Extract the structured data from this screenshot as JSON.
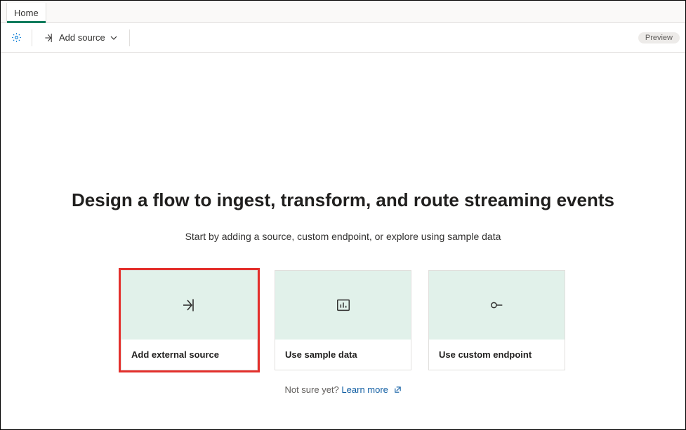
{
  "tabs": {
    "home": "Home"
  },
  "toolbar": {
    "add_source_label": "Add source",
    "preview_badge": "Preview"
  },
  "main": {
    "headline": "Design a flow to ingest, transform, and route streaming events",
    "subhead": "Start by adding a source, custom endpoint, or explore using sample data"
  },
  "cards": {
    "external": "Add external source",
    "sample": "Use sample data",
    "endpoint": "Use custom endpoint"
  },
  "footer": {
    "not_sure": "Not sure yet?",
    "learn_more": "Learn more"
  }
}
